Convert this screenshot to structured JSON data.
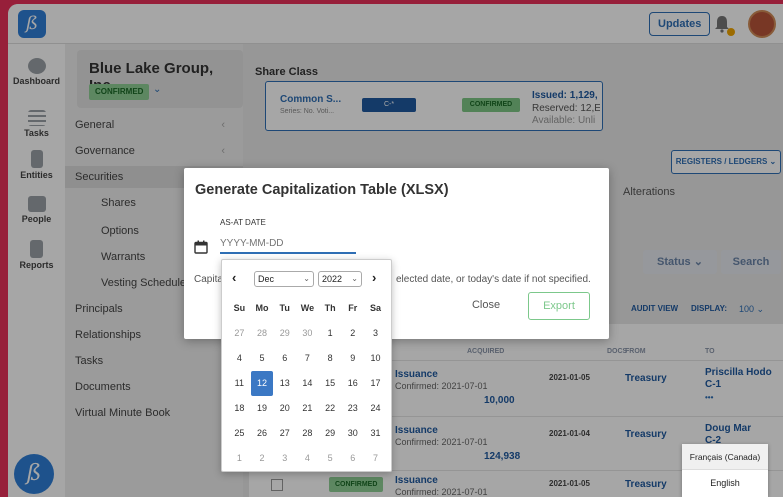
{
  "topbar": {
    "updates_label": "Updates"
  },
  "nav": {
    "items": [
      {
        "label": "Dashboard",
        "icon": "dashboard-icon"
      },
      {
        "label": "Tasks",
        "icon": "tasks-icon"
      },
      {
        "label": "Entities",
        "icon": "entities-icon"
      },
      {
        "label": "People",
        "icon": "people-icon"
      },
      {
        "label": "Reports",
        "icon": "reports-icon"
      }
    ]
  },
  "company": {
    "name": "Blue Lake Group, Inc.",
    "status": "CONFIRMED"
  },
  "sidebar": {
    "items": [
      {
        "label": "General"
      },
      {
        "label": "Governance"
      },
      {
        "label": "Securities"
      },
      {
        "label": "Shares"
      },
      {
        "label": "Options"
      },
      {
        "label": "Warrants"
      },
      {
        "label": "Vesting Schedules"
      },
      {
        "label": "Principals"
      },
      {
        "label": "Relationships"
      },
      {
        "label": "Tasks"
      },
      {
        "label": "Documents"
      },
      {
        "label": "Virtual Minute Book"
      }
    ]
  },
  "share_class": {
    "section_label": "Share Class",
    "name": "Common S...",
    "series": "Series: No. Voti...",
    "code": "C-*",
    "status": "CONFIRMED",
    "issued": "Issued: 1,129,",
    "reserved": "Reserved: 12,E",
    "available": "Available: Unli"
  },
  "main": {
    "registers_label": "REGISTERS / LEDGERS",
    "alterations": "Alterations",
    "status_label": "Status",
    "search_label": "Search",
    "audit_view": "AUDIT VIEW",
    "display_label": "DISPLAY:",
    "display_value": "100"
  },
  "table": {
    "headers": {
      "acquired": "ACQUIRED",
      "docs": "DOCS",
      "from": "FROM",
      "to": "TO"
    },
    "rows": [
      {
        "type": "Issuance",
        "confirmed": "Confirmed: 2021-07-01",
        "qty": "10,000",
        "date": "2021-01-05",
        "from": "Treasury",
        "to": "Priscilla Hodo",
        "to_sub": "C-1",
        "extra": "•••"
      },
      {
        "type": "Issuance",
        "confirmed": "Confirmed: 2021-07-01",
        "qty": "124,938",
        "date": "2021-01-04",
        "from": "Treasury",
        "to": "Doug Mar",
        "to_sub": "C-2"
      },
      {
        "type": "Issuance",
        "confirmed": "Confirmed: 2021-07-01",
        "qty": "",
        "date": "2021-01-05",
        "from": "Treasury",
        "to": "",
        "status": "CONFIRMED"
      }
    ]
  },
  "modal": {
    "title": "Generate Capitalization Table (XLSX)",
    "as_at_label": "AS-AT DATE",
    "date_placeholder": "YYYY-MM-DD",
    "help_prefix": "Capita",
    "help_suffix": "elected date, or today's date if not specified.",
    "close_label": "Close",
    "export_label": "Export"
  },
  "datepicker": {
    "month": "Dec",
    "year": "2022",
    "weekdays": [
      "Su",
      "Mo",
      "Tu",
      "We",
      "Th",
      "Fr",
      "Sa"
    ],
    "weeks": [
      [
        "27",
        "28",
        "29",
        "30",
        "1",
        "2",
        "3"
      ],
      [
        "4",
        "5",
        "6",
        "7",
        "8",
        "9",
        "10"
      ],
      [
        "11",
        "12",
        "13",
        "14",
        "15",
        "16",
        "17"
      ],
      [
        "18",
        "19",
        "20",
        "21",
        "22",
        "23",
        "24"
      ],
      [
        "25",
        "26",
        "27",
        "28",
        "29",
        "30",
        "31"
      ],
      [
        "1",
        "2",
        "3",
        "4",
        "5",
        "6",
        "7"
      ]
    ],
    "selected": "12"
  },
  "language": {
    "options": [
      "Français (Canada)",
      "English"
    ]
  },
  "colors": {
    "accent": "#2f6fb5",
    "confirmed": "#8fcf96",
    "background": "#e9305a"
  }
}
